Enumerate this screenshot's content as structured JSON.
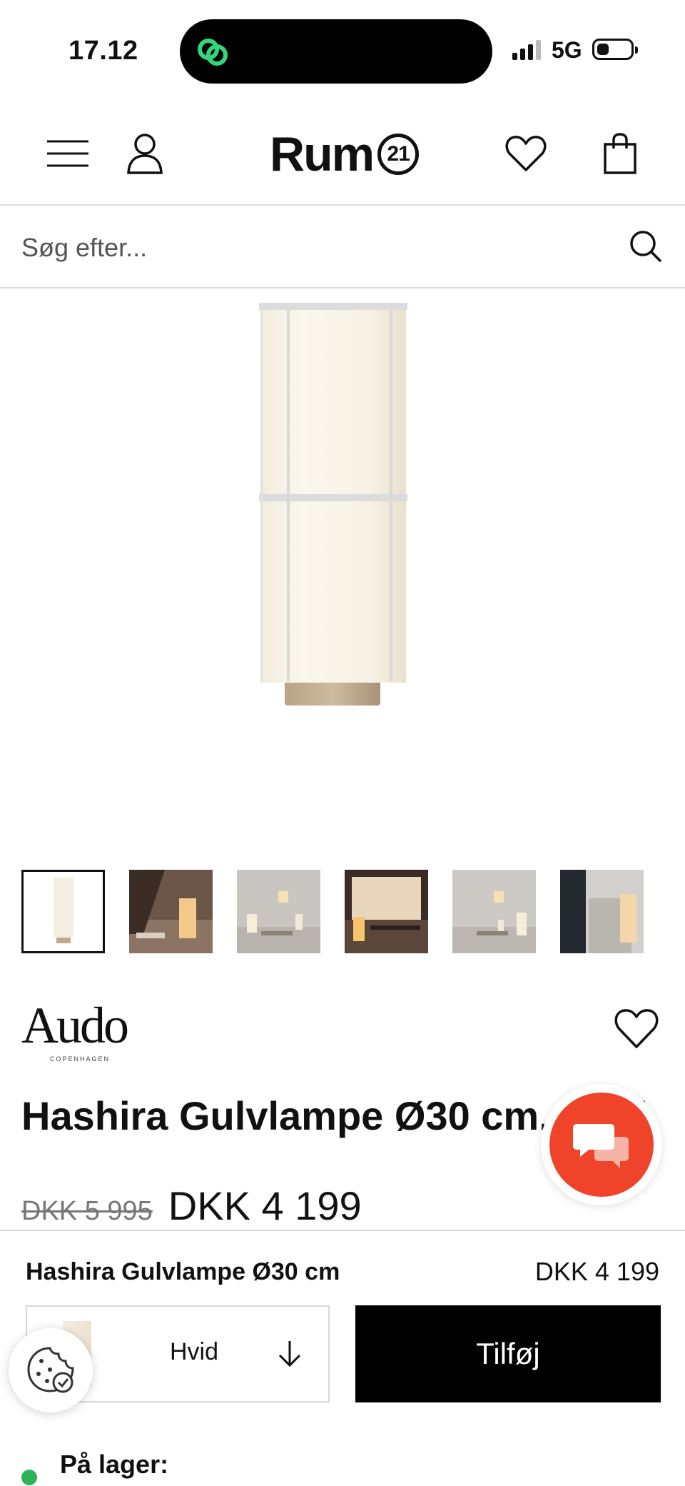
{
  "status_bar": {
    "time": "17.12",
    "network": "5G"
  },
  "header": {
    "logo_text": "Rum",
    "logo_badge": "21"
  },
  "search": {
    "placeholder": "Søg efter..."
  },
  "product": {
    "brand": "Audo",
    "brand_sub": "COPENHAGEN",
    "title": "Hashira Gulvlampe Ø30 cm, Hvid",
    "old_price": "DKK 5 995",
    "price": "DKK 4 199",
    "thumbnail_count": 6
  },
  "sticky_bar": {
    "name": "Hashira Gulvlampe Ø30 cm",
    "price": "DKK 4 199",
    "variant": "Hvid",
    "add_label": "Tilføj",
    "stock_label": "På lager:"
  },
  "colors": {
    "chat": "#f0442a",
    "stock": "#2cb35a",
    "cta": "#000000"
  }
}
